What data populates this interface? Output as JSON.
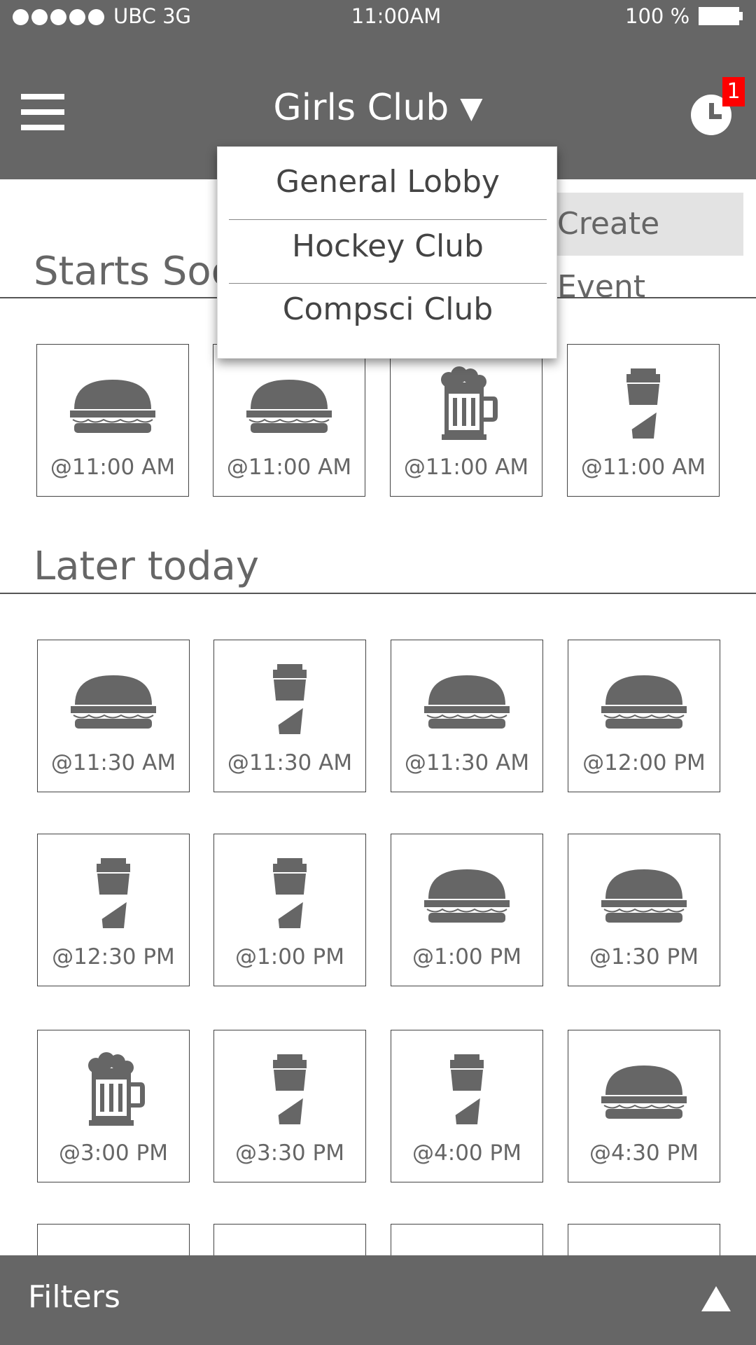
{
  "status_bar": {
    "carrier": "UBC  3G",
    "time": "11:00AM",
    "battery": "100 %"
  },
  "header": {
    "club_name": "Girls Club",
    "notification_count": "1"
  },
  "club_dropdown": {
    "options": [
      "General Lobby",
      "Hockey Club",
      "Compsci Club"
    ]
  },
  "create_event_label": "Create Event",
  "sections": {
    "starts_soon": {
      "title": "Starts Soon",
      "events": [
        {
          "icon": "burger-icon",
          "time": "@11:00 AM"
        },
        {
          "icon": "burger-icon",
          "time": "@11:00 AM"
        },
        {
          "icon": "beer-icon",
          "time": "@11:00 AM"
        },
        {
          "icon": "coffee-cup-icon",
          "time": "@11:00 AM"
        }
      ]
    },
    "later_today": {
      "title": "Later today",
      "events": [
        {
          "icon": "burger-icon",
          "time": "@11:30 AM"
        },
        {
          "icon": "coffee-cup-icon",
          "time": "@11:30 AM"
        },
        {
          "icon": "burger-icon",
          "time": "@11:30 AM"
        },
        {
          "icon": "burger-icon",
          "time": "@12:00 PM"
        },
        {
          "icon": "coffee-cup-icon",
          "time": "@12:30 PM"
        },
        {
          "icon": "coffee-cup-icon",
          "time": "@1:00 PM"
        },
        {
          "icon": "burger-icon",
          "time": "@1:00 PM"
        },
        {
          "icon": "burger-icon",
          "time": "@1:30 PM"
        },
        {
          "icon": "beer-icon",
          "time": "@3:00 PM"
        },
        {
          "icon": "coffee-cup-icon",
          "time": "@3:30 PM"
        },
        {
          "icon": "coffee-cup-icon",
          "time": "@4:00 PM"
        },
        {
          "icon": "burger-icon",
          "time": "@4:30 PM"
        }
      ]
    }
  },
  "filters_label": "Filters",
  "colors": {
    "bar": "#666666",
    "badge": "#ff0000",
    "create_button_bg": "#e3e3e3"
  }
}
